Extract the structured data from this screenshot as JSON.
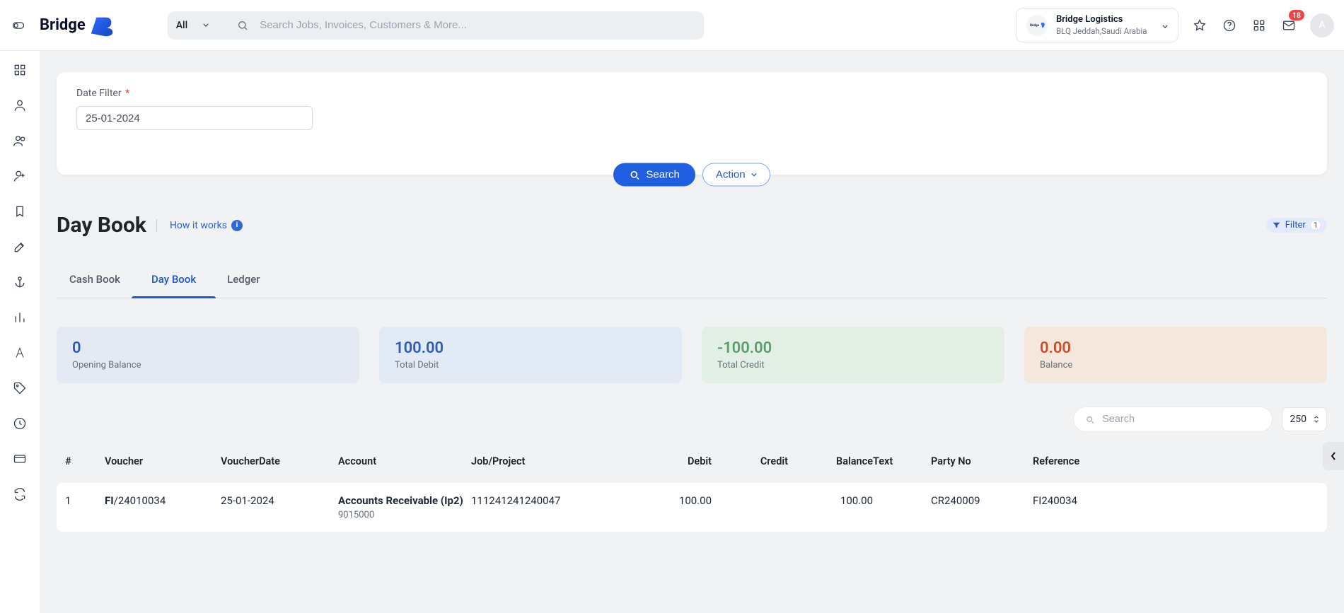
{
  "header": {
    "logo_text": "Bridge",
    "search": {
      "filter_label": "All",
      "placeholder": "Search Jobs, Invoices, Customers & More..."
    },
    "org": {
      "name": "Bridge Logistics",
      "location": "BLQ Jeddah,Saudi Arabia"
    },
    "notifications_count": "18",
    "avatar_letter": "A"
  },
  "filter_panel": {
    "date_filter_label": "Date Filter",
    "date_filter_required": "*",
    "date_filter_value": "25-01-2024",
    "search_label": "Search",
    "action_label": "Action"
  },
  "page": {
    "title": "Day Book",
    "how_it_works": "How it works",
    "filter_label": "Filter",
    "filter_count": "1"
  },
  "tabs": [
    {
      "id": "cashbook",
      "label": "Cash Book",
      "active": false
    },
    {
      "id": "daybook",
      "label": "Day Book",
      "active": true
    },
    {
      "id": "ledger",
      "label": "Ledger",
      "active": false
    }
  ],
  "stats": {
    "opening": {
      "value": "0",
      "label": "Opening Balance"
    },
    "debit": {
      "value": "100.00",
      "label": "Total Debit"
    },
    "credit": {
      "value": "-100.00",
      "label": "Total Credit"
    },
    "balance": {
      "value": "0.00",
      "label": "Balance"
    }
  },
  "table": {
    "search_placeholder": "Search",
    "page_size": "250",
    "columns": [
      "#",
      "Voucher",
      "VoucherDate",
      "Account",
      "Job/Project",
      "Debit",
      "Credit",
      "Balance",
      "Text",
      "Party No",
      "Reference"
    ],
    "rows": [
      {
        "idx": "1",
        "voucher_prefix": "FI",
        "voucher_rest": "/24010034",
        "voucher_date": "25-01-2024",
        "account_name": "Accounts Receivable (Ip2)",
        "account_code": "9015000",
        "job": "111241241240047",
        "debit": "100.00",
        "credit": "",
        "balance": "100.00",
        "text": "",
        "party_no": "CR240009",
        "reference": "FI240034"
      }
    ]
  }
}
